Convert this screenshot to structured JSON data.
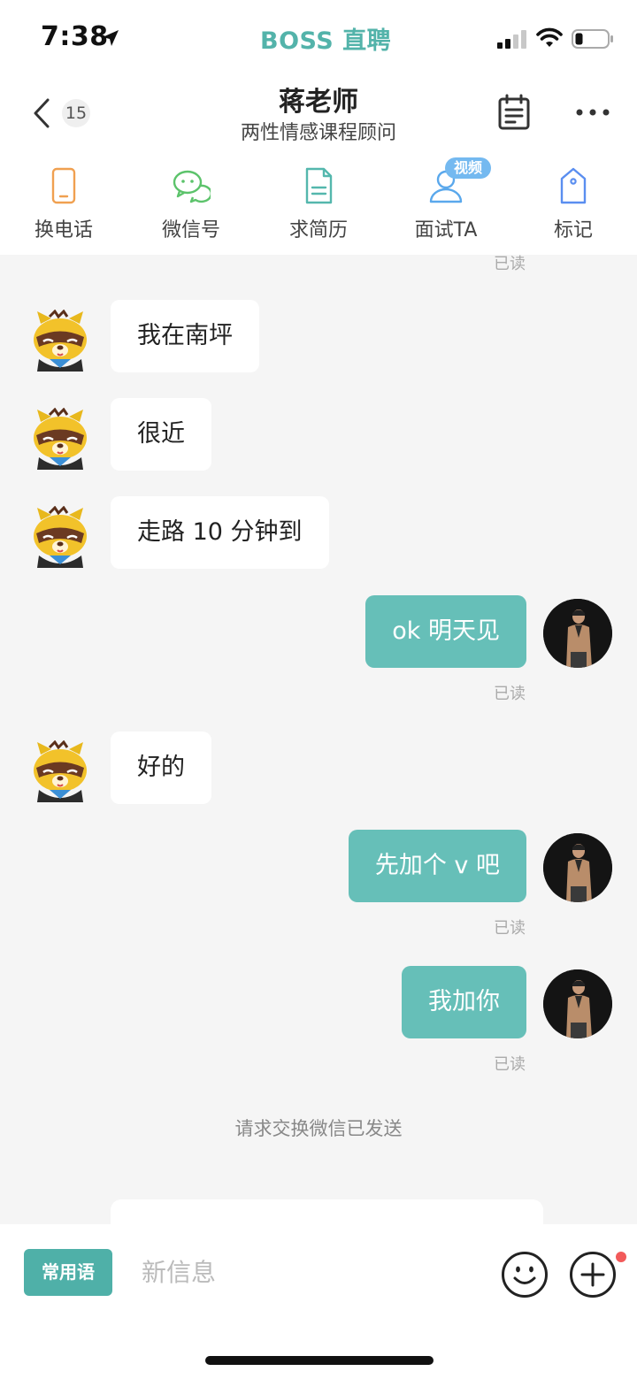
{
  "status_bar": {
    "time": "7:38",
    "brand": "BOSS 直聘"
  },
  "header": {
    "unread_count": "15",
    "title": "蒋老师",
    "subtitle": "两性情感课程顾问"
  },
  "actions": [
    {
      "label": "换电话",
      "icon": "phone-icon",
      "color": "#f0a050"
    },
    {
      "label": "微信号",
      "icon": "wechat-icon",
      "color": "#5cc36b"
    },
    {
      "label": "求简历",
      "icon": "resume-icon",
      "color": "#54b7ad"
    },
    {
      "label": "面试TA",
      "icon": "interview-icon",
      "color": "#5aa8ec",
      "badge": "视频"
    },
    {
      "label": "标记",
      "icon": "tag-icon",
      "color": "#5a8ef0"
    }
  ],
  "read_label": "已读",
  "messages": [
    {
      "from": "them",
      "text": "我在南坪"
    },
    {
      "from": "them",
      "text": "很近"
    },
    {
      "from": "them",
      "text": "走路 10 分钟到"
    },
    {
      "from": "me",
      "text": "ok  明天见"
    },
    {
      "from": "them",
      "text": "好的"
    },
    {
      "from": "me",
      "text": "先加个 v 吧"
    },
    {
      "from": "me",
      "text": "我加你"
    }
  ],
  "system_note": "请求交换微信已发送",
  "input": {
    "phrases_label": "常用语",
    "placeholder": "新信息",
    "value": ""
  },
  "colors": {
    "accent": "#53b3aa",
    "bubble_out": "#66bfb8",
    "background": "#f5f5f5",
    "notification_dot": "#f25a5a"
  }
}
